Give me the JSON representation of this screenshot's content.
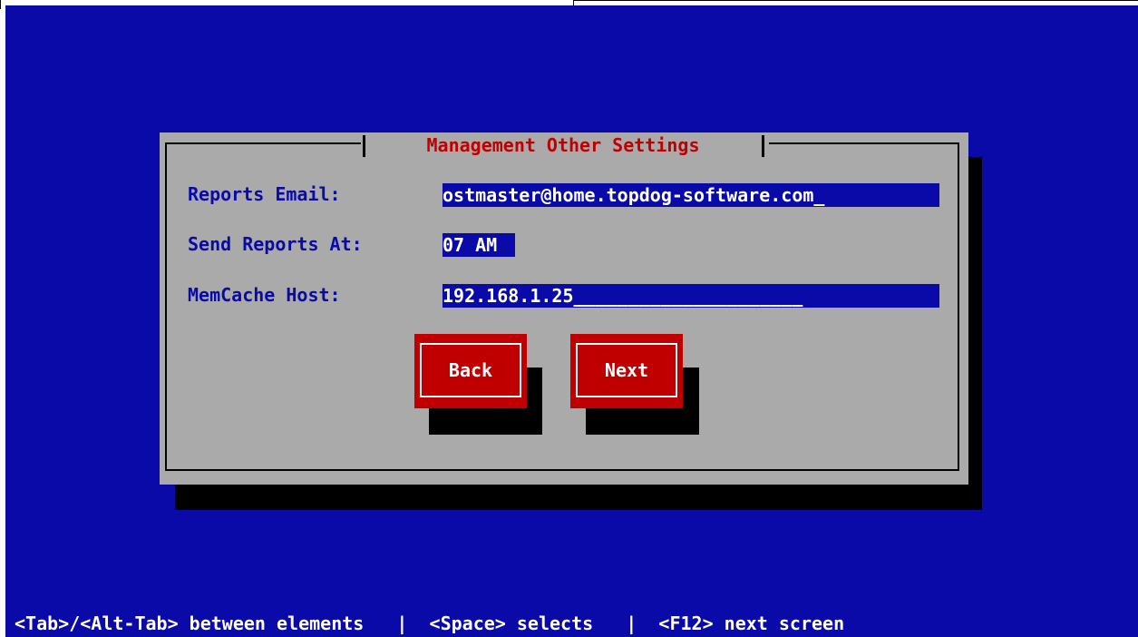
{
  "dialog": {
    "title": "Management Other Settings",
    "fields": [
      {
        "label": "Reports Email:",
        "value": "ostmaster@home.topdog-software.com_"
      },
      {
        "label": "Send Reports At:",
        "value": "07 AM"
      },
      {
        "label": "MemCache Host:",
        "value": "192.168.1.25_____________________"
      }
    ],
    "buttons": {
      "back": "Back",
      "next": "Next"
    }
  },
  "hint_bar": "<Tab>/<Alt-Tab> between elements   |  <Space> selects   |  <F12> next screen",
  "colors": {
    "background": "#0a0aa8",
    "dialog": "#aaaaaa",
    "accent": "#c00000",
    "text": "#0a0aa8"
  }
}
